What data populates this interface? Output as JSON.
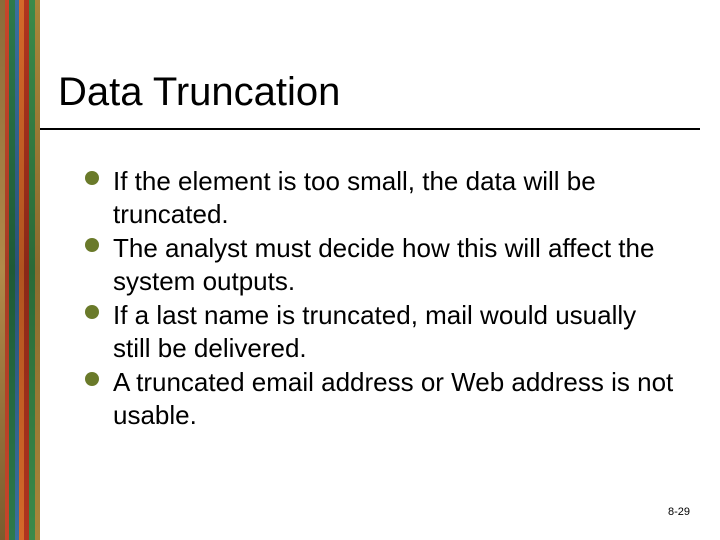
{
  "title": "Data Truncation",
  "bullets": [
    "If the element is too small, the data will be truncated.",
    "The analyst must decide how this will affect the system outputs.",
    "If a last name is truncated, mail would usually still be delivered.",
    "A truncated email address or Web address is not usable."
  ],
  "page_number": "8-29"
}
